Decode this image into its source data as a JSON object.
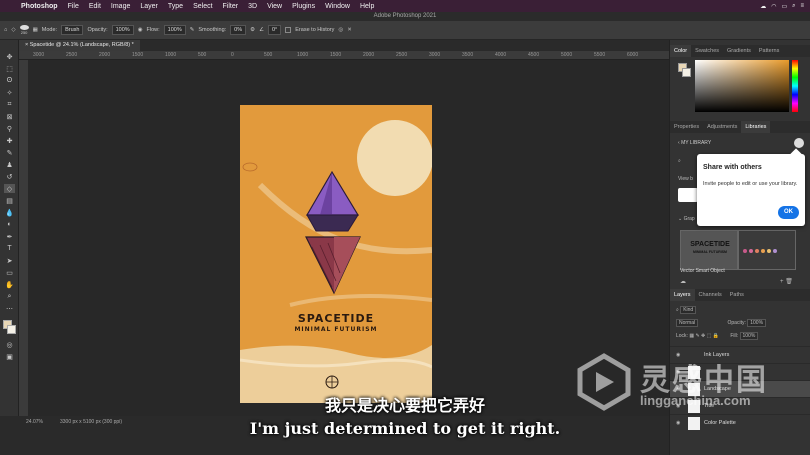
{
  "menubar": {
    "apple": "",
    "items": [
      "Photoshop",
      "File",
      "Edit",
      "Image",
      "Layer",
      "Type",
      "Select",
      "Filter",
      "3D",
      "View",
      "Plugins",
      "Window",
      "Help"
    ]
  },
  "window_title": "Adobe Photoshop 2021",
  "options": {
    "brush_size": "250",
    "mode_label": "Mode:",
    "mode_value": "Brush",
    "opacity_label": "Opacity:",
    "opacity_value": "100%",
    "flow_label": "Flow:",
    "flow_value": "100%",
    "smoothing_label": "Smoothing:",
    "smoothing_value": "0%",
    "angle_value": "0°",
    "erase_history": "Erase to History"
  },
  "document_tab": "Spacetide @ 24.1% (Landscape, RGB/8) *",
  "ruler_marks": [
    "3000",
    "2500",
    "2000",
    "1500",
    "1000",
    "500",
    "0",
    "500",
    "1000",
    "1500",
    "2000",
    "2500",
    "3000",
    "3500",
    "4000",
    "4500",
    "5000",
    "5500",
    "6000"
  ],
  "poster": {
    "title": "SPACETIDE",
    "subtitle": "MINIMAL FUTURISM",
    "bg_color": "#e29a3c"
  },
  "status": {
    "zoom": "24.07%",
    "dimensions": "3300 px x 5100 px (300 ppi)"
  },
  "color_panel": {
    "tabs": [
      "Color",
      "Swatches",
      "Gradients",
      "Patterns"
    ],
    "foreground": "#e8d7b6"
  },
  "library_panel": {
    "tabs": [
      "Properties",
      "Adjustments",
      "Libraries"
    ],
    "library_name": "MY LIBRARY",
    "view_label": "View b",
    "graphics_label": "Grap",
    "item_title": "SPACETIDE",
    "item_subtitle": "MINIMAL FUTURISM",
    "item_caption": "Vector Smart Object",
    "swatch_colors": [
      "#c85a8a",
      "#d66b9a",
      "#e08060",
      "#e8a050",
      "#e8c070",
      "#b090d0"
    ]
  },
  "share_popup": {
    "title": "Share with others",
    "description": "Invite people to edit or use your library.",
    "ok_label": "OK"
  },
  "layers_panel": {
    "tabs": [
      "Layers",
      "Channels",
      "Paths"
    ],
    "filter_label": "Kind",
    "blend_mode": "Normal",
    "opacity_label": "Opacity:",
    "opacity_value": "100%",
    "lock_label": "Lock:",
    "fill_label": "Fill:",
    "fill_value": "100%",
    "layers": [
      "Ink Layers",
      "",
      "Landscape",
      "Title",
      "Color Palette"
    ]
  },
  "subtitles": {
    "chinese": "我只是决心要把它弄好",
    "english": "I'm just determined to get it right."
  },
  "watermark": {
    "cn": "灵感中国",
    "url": "lingganchina.com"
  }
}
